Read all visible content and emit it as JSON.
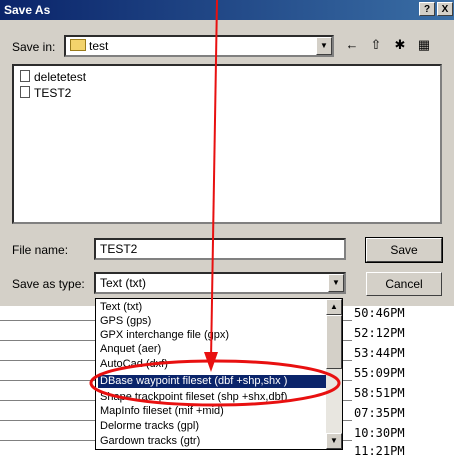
{
  "window": {
    "title": "Save As",
    "help_button": "?",
    "close_button": "X"
  },
  "save_in": {
    "label": "Save in:",
    "value": "test"
  },
  "files": [
    {
      "name": "deletetest"
    },
    {
      "name": "TEST2"
    }
  ],
  "file_name": {
    "label": "File name:",
    "value": "TEST2"
  },
  "save_as_type": {
    "label": "Save as type:",
    "value": "Text (txt)"
  },
  "buttons": {
    "save": "Save",
    "cancel": "Cancel"
  },
  "dropdown": {
    "options": [
      "Text (txt)",
      "GPS (gps)",
      "GPX interchange file (gpx)",
      "Anquet (aer)",
      "AutoCad (dxf)",
      "DBase waypoint fileset (dbf +shp,shx )",
      "Shape trackpoint fileset (shp +shx,dbf)",
      "MapInfo fileset (mif +mid)",
      "Delorme tracks (gpl)",
      "Gardown tracks (gtr)"
    ],
    "selected_index": 5
  },
  "background_times": [
    "50:46PM",
    "52:12PM",
    "53:44PM",
    "55:09PM",
    "58:51PM",
    "07:35PM",
    "10:30PM",
    "11:21PM"
  ],
  "annotation": {
    "color": "#e81010"
  }
}
